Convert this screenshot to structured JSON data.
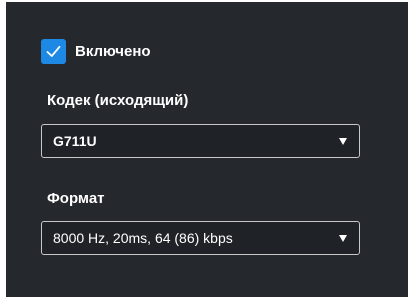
{
  "enabled": {
    "label": "Включено",
    "checked": true,
    "accent_color": "#1e88e5"
  },
  "codec": {
    "label": "Кодек (исходящий)",
    "value": "G711U",
    "icon": "chevron-down-icon"
  },
  "format": {
    "label": "Формат",
    "value": "8000 Hz, 20ms, 64 (86) kbps",
    "icon": "chevron-down-icon"
  }
}
